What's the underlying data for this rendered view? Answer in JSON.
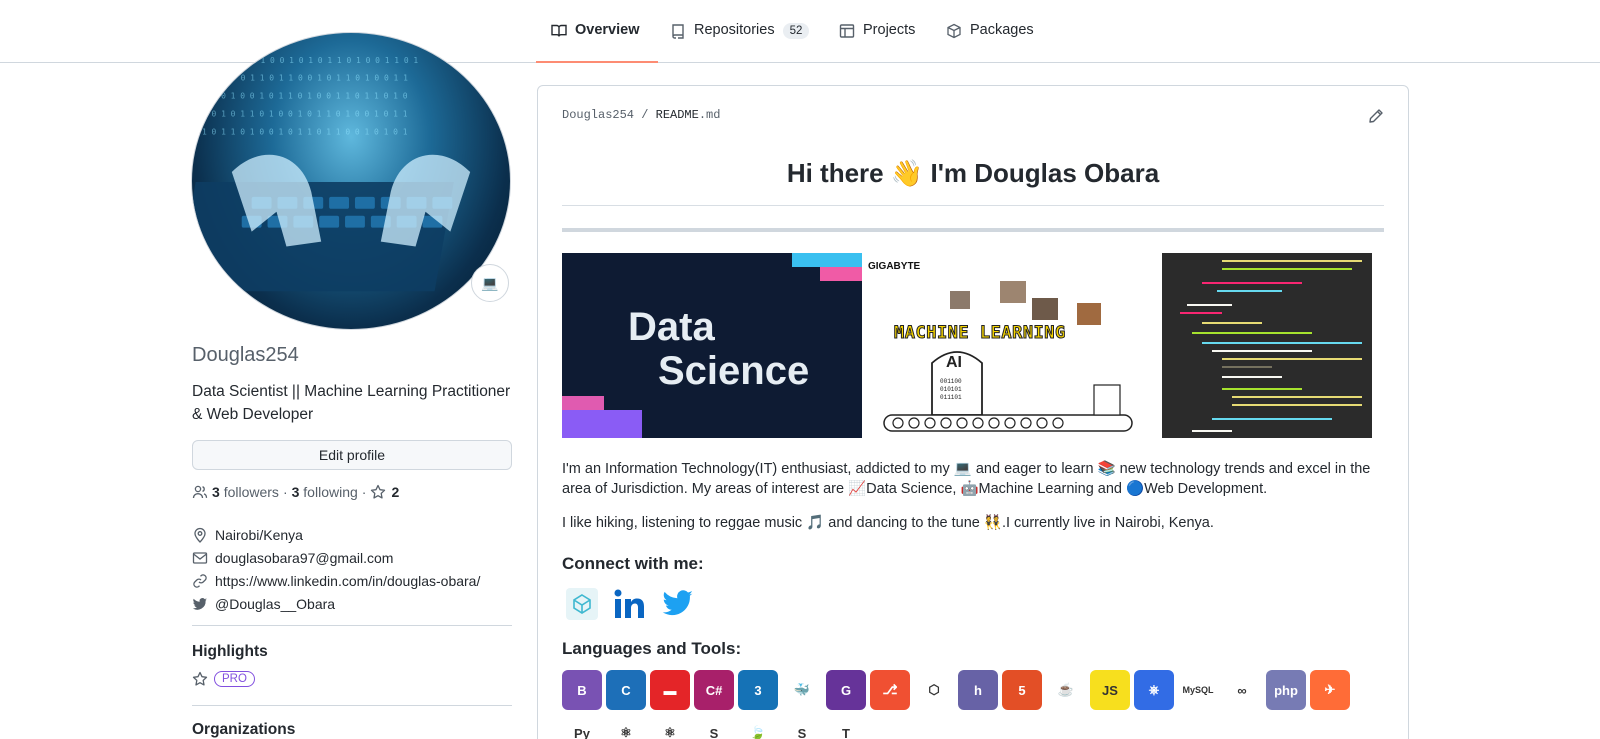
{
  "tabs": [
    {
      "label": "Overview",
      "icon": "book-icon",
      "selected": true
    },
    {
      "label": "Repositories",
      "icon": "repo-icon",
      "count": "52"
    },
    {
      "label": "Projects",
      "icon": "table-icon"
    },
    {
      "label": "Packages",
      "icon": "package-icon"
    }
  ],
  "profile": {
    "status_emoji": "💻",
    "username": "Douglas254",
    "bio": "Data Scientist || Machine Learning Practitioner & Web Developer",
    "edit_label": "Edit profile",
    "followers_count": "3",
    "followers_label": "followers",
    "sep": "·",
    "following_count": "3",
    "following_label": "following",
    "stars_count": "2",
    "location": "Nairobi/Kenya",
    "email": "douglasobara97@gmail.com",
    "website": "https://www.linkedin.com/in/douglas-obara/",
    "twitter": "@Douglas__Obara"
  },
  "highlights": {
    "heading": "Highlights",
    "badge": "PRO"
  },
  "organizations": {
    "heading": "Organizations"
  },
  "readme": {
    "owner": "Douglas254",
    "slash": "/",
    "file_name": "README",
    "file_ext": ".md",
    "greeting_pre": "Hi there",
    "greeting_emoji": "👋",
    "greeting_post": "I'm Douglas Obara",
    "banner1_line1": "Data",
    "banner1_line2": "Science",
    "banner2_brand": "GIGABYTE",
    "banner2_title": "MACHINE LEARNING",
    "banner2_ai": "AI",
    "intro": "I'm an Information Technology(IT) enthusiast, addicted to my 💻 and eager to learn 📚 new technology trends and excel in the area of Jurisdiction. My areas of interest are 📈Data Science, 🤖Machine Learning and 🔵Web Development.",
    "hobbies": "I like hiking, listening to reggae music 🎵 and dancing to the tune 👯.I currently live in Nairobi, Kenya.",
    "connect_heading": "Connect with me:",
    "tools_heading": "Languages and Tools:"
  },
  "social_icons": [
    "codepen-icon",
    "linkedin-icon",
    "twitter-icon"
  ],
  "tools": [
    {
      "name": "bootstrap-icon",
      "text": "B",
      "color": "#7952b3"
    },
    {
      "name": "c-icon",
      "text": "C",
      "color": "#1d6fb8"
    },
    {
      "name": "couchdb-icon",
      "text": "▬",
      "color": "#e42528"
    },
    {
      "name": "csharp-icon",
      "text": "C#",
      "color": "#a8206a"
    },
    {
      "name": "css3-icon",
      "text": "3",
      "color": "#1572b6"
    },
    {
      "name": "docker-icon",
      "text": "🐳",
      "color": "#ffffff"
    },
    {
      "name": "gatsby-icon",
      "text": "G",
      "color": "#663399"
    },
    {
      "name": "git-icon",
      "text": "⎇",
      "color": "#f05032"
    },
    {
      "name": "graphql-icon",
      "text": "⬡",
      "color": "#ffffff"
    },
    {
      "name": "heroku-icon",
      "text": "h",
      "color": "#6762a6"
    },
    {
      "name": "html5-icon",
      "text": "5",
      "color": "#e34f26"
    },
    {
      "name": "java-icon",
      "text": "☕",
      "color": "#ffffff"
    },
    {
      "name": "javascript-icon",
      "text": "JS",
      "color": "#f7df1e"
    },
    {
      "name": "kubernetes-icon",
      "text": "⎈",
      "color": "#326ce5"
    },
    {
      "name": "mysql-icon",
      "text": "MySQL",
      "color": "#ffffff"
    },
    {
      "name": "nodered-icon",
      "text": "∞",
      "color": "#ffffff"
    },
    {
      "name": "php-icon",
      "text": "php",
      "color": "#777bb4"
    },
    {
      "name": "postman-icon",
      "text": "✈",
      "color": "#ff6c37"
    },
    {
      "name": "python-icon",
      "text": "Py",
      "color": "#ffffff"
    },
    {
      "name": "react-icon",
      "text": "⚛",
      "color": "#ffffff"
    },
    {
      "name": "reactnative-icon",
      "text": "⚛",
      "color": "#ffffff"
    },
    {
      "name": "sass-icon",
      "text": "S",
      "color": "#ffffff"
    },
    {
      "name": "spring-icon",
      "text": "🍃",
      "color": "#ffffff"
    },
    {
      "name": "swift-icon",
      "text": "S",
      "color": "#ffffff"
    },
    {
      "name": "tensorflow-icon",
      "text": "T",
      "color": "#ffffff"
    }
  ]
}
